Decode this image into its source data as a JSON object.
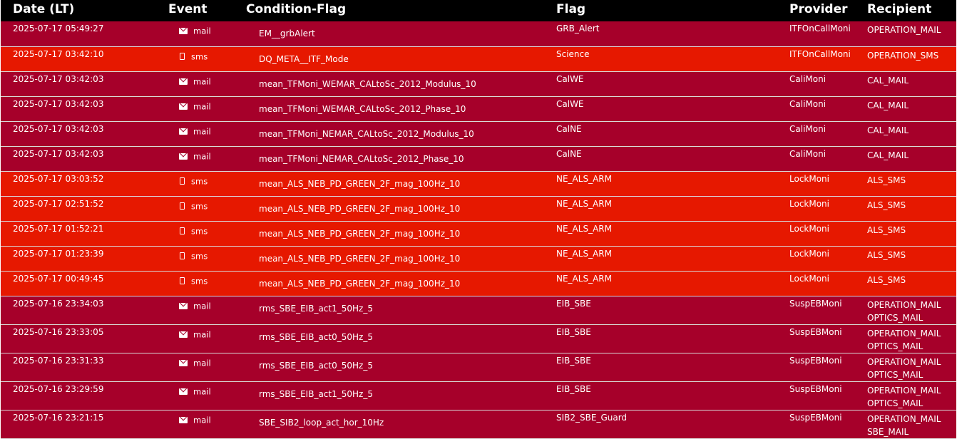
{
  "table": {
    "headers": {
      "date": "Date (LT)",
      "event": "Event",
      "condition": "Condition-Flag",
      "flag": "Flag",
      "provider": "Provider",
      "recipient": "Recipient"
    },
    "colors": {
      "mail_row": "#a6002a",
      "sms_row": "#e61800",
      "header": "#000000"
    },
    "rows": [
      {
        "date": "2025-07-17 05:49:27",
        "event": "mail",
        "event_icon": "envelope-icon",
        "condition": "EM__grbAlert",
        "flag": "GRB_Alert",
        "provider": "ITFOnCallMoni",
        "recipients": [
          "OPERATION_MAIL"
        ]
      },
      {
        "date": "2025-07-17 03:42:10",
        "event": "sms",
        "event_icon": "phone-icon",
        "condition": "DQ_META__ITF_Mode",
        "flag": "Science",
        "provider": "ITFOnCallMoni",
        "recipients": [
          "OPERATION_SMS"
        ]
      },
      {
        "date": "2025-07-17 03:42:03",
        "event": "mail",
        "event_icon": "envelope-icon",
        "condition": "mean_TFMoni_WEMAR_CALtoSc_2012_Modulus_10",
        "flag": "CalWE",
        "provider": "CaliMoni",
        "recipients": [
          "CAL_MAIL"
        ]
      },
      {
        "date": "2025-07-17 03:42:03",
        "event": "mail",
        "event_icon": "envelope-icon",
        "condition": "mean_TFMoni_WEMAR_CALtoSc_2012_Phase_10",
        "flag": "CalWE",
        "provider": "CaliMoni",
        "recipients": [
          "CAL_MAIL"
        ]
      },
      {
        "date": "2025-07-17 03:42:03",
        "event": "mail",
        "event_icon": "envelope-icon",
        "condition": "mean_TFMoni_NEMAR_CALtoSc_2012_Modulus_10",
        "flag": "CalNE",
        "provider": "CaliMoni",
        "recipients": [
          "CAL_MAIL"
        ]
      },
      {
        "date": "2025-07-17 03:42:03",
        "event": "mail",
        "event_icon": "envelope-icon",
        "condition": "mean_TFMoni_NEMAR_CALtoSc_2012_Phase_10",
        "flag": "CalNE",
        "provider": "CaliMoni",
        "recipients": [
          "CAL_MAIL"
        ]
      },
      {
        "date": "2025-07-17 03:03:52",
        "event": "sms",
        "event_icon": "phone-icon",
        "condition": "mean_ALS_NEB_PD_GREEN_2F_mag_100Hz_10",
        "flag": "NE_ALS_ARM",
        "provider": "LockMoni",
        "recipients": [
          "ALS_SMS"
        ]
      },
      {
        "date": "2025-07-17 02:51:52",
        "event": "sms",
        "event_icon": "phone-icon",
        "condition": "mean_ALS_NEB_PD_GREEN_2F_mag_100Hz_10",
        "flag": "NE_ALS_ARM",
        "provider": "LockMoni",
        "recipients": [
          "ALS_SMS"
        ]
      },
      {
        "date": "2025-07-17 01:52:21",
        "event": "sms",
        "event_icon": "phone-icon",
        "condition": "mean_ALS_NEB_PD_GREEN_2F_mag_100Hz_10",
        "flag": "NE_ALS_ARM",
        "provider": "LockMoni",
        "recipients": [
          "ALS_SMS"
        ]
      },
      {
        "date": "2025-07-17 01:23:39",
        "event": "sms",
        "event_icon": "phone-icon",
        "condition": "mean_ALS_NEB_PD_GREEN_2F_mag_100Hz_10",
        "flag": "NE_ALS_ARM",
        "provider": "LockMoni",
        "recipients": [
          "ALS_SMS"
        ]
      },
      {
        "date": "2025-07-17 00:49:45",
        "event": "sms",
        "event_icon": "phone-icon",
        "condition": "mean_ALS_NEB_PD_GREEN_2F_mag_100Hz_10",
        "flag": "NE_ALS_ARM",
        "provider": "LockMoni",
        "recipients": [
          "ALS_SMS"
        ]
      },
      {
        "date": "2025-07-16 23:34:03",
        "event": "mail",
        "event_icon": "envelope-icon",
        "condition": "rms_SBE_EIB_act1_50Hz_5",
        "flag": "EIB_SBE",
        "provider": "SuspEBMoni",
        "recipients": [
          "OPERATION_MAIL",
          "OPTICS_MAIL"
        ]
      },
      {
        "date": "2025-07-16 23:33:05",
        "event": "mail",
        "event_icon": "envelope-icon",
        "condition": "rms_SBE_EIB_act0_50Hz_5",
        "flag": "EIB_SBE",
        "provider": "SuspEBMoni",
        "recipients": [
          "OPERATION_MAIL",
          "OPTICS_MAIL"
        ]
      },
      {
        "date": "2025-07-16 23:31:33",
        "event": "mail",
        "event_icon": "envelope-icon",
        "condition": "rms_SBE_EIB_act0_50Hz_5",
        "flag": "EIB_SBE",
        "provider": "SuspEBMoni",
        "recipients": [
          "OPERATION_MAIL",
          "OPTICS_MAIL"
        ]
      },
      {
        "date": "2025-07-16 23:29:59",
        "event": "mail",
        "event_icon": "envelope-icon",
        "condition": "rms_SBE_EIB_act1_50Hz_5",
        "flag": "EIB_SBE",
        "provider": "SuspEBMoni",
        "recipients": [
          "OPERATION_MAIL",
          "OPTICS_MAIL"
        ]
      },
      {
        "date": "2025-07-16 23:21:15",
        "event": "mail",
        "event_icon": "envelope-icon",
        "condition": "SBE_SIB2_loop_act_hor_10Hz",
        "flag": "SIB2_SBE_Guard",
        "provider": "SuspEBMoni",
        "recipients": [
          "OPERATION_MAIL",
          "SBE_MAIL"
        ]
      }
    ]
  }
}
